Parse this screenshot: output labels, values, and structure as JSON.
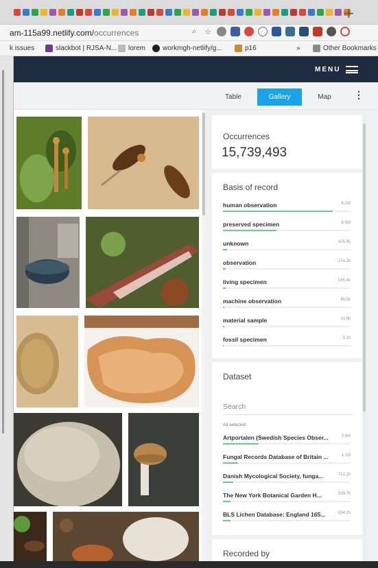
{
  "browser": {
    "url_host": "am-115a99.netlify.com/",
    "url_path": "occurrences",
    "new_tab_symbol": "+",
    "bookmarks": [
      {
        "label": "k issues",
        "icon": "plain"
      },
      {
        "label": "slackbot | RJSA-N...",
        "icon": "slack-icon"
      },
      {
        "label": "lorem",
        "icon": "page-icon"
      },
      {
        "label": "workmgh-netlify/g...",
        "icon": "github-icon"
      },
      {
        "label": "p16",
        "icon": "user-icon"
      },
      {
        "label": "»",
        "icon": "plain"
      },
      {
        "label": "Other Bookmarks",
        "icon": "folder-icon"
      }
    ],
    "accent_colors": [
      "#d84a3a",
      "#3a7bd5",
      "#2ba84a",
      "#f0b429",
      "#9b59b6",
      "#e67e22",
      "#16a085",
      "#c0392b"
    ]
  },
  "header": {
    "menu_label": "MENU"
  },
  "view_tabs": [
    {
      "label": "Table",
      "active": false
    },
    {
      "label": "Gallery",
      "active": true
    },
    {
      "label": "Map",
      "active": false
    }
  ],
  "more_symbol": "⋮",
  "occurrences": {
    "title": "Occurrences",
    "count": "15,739,493"
  },
  "basis_of_record": {
    "title": "Basis of record",
    "items": [
      {
        "label": "human observation",
        "count": "6.2M",
        "fraction": 0.86
      },
      {
        "label": "preserved specimen",
        "count": "6.5M",
        "fraction": 0.42
      },
      {
        "label": "unknown",
        "count": "425.8k",
        "fraction": 0.03
      },
      {
        "label": "observation",
        "count": "274.2k",
        "fraction": 0.02
      },
      {
        "label": "living specimen",
        "count": "165.4k",
        "fraction": 0.02
      },
      {
        "label": "machine observation",
        "count": "45.5k",
        "fraction": 0.01
      },
      {
        "label": "material sample",
        "count": "33.6k",
        "fraction": 0.01
      },
      {
        "label": "fossil specimen",
        "count": "3.1k",
        "fraction": 0.005
      }
    ]
  },
  "dataset": {
    "title": "Dataset",
    "search_label": "Search",
    "all_selected": "All selected",
    "items": [
      {
        "label": "Artportalen (Swedish Species Obser...",
        "count": "2.4M",
        "fraction": 0.28
      },
      {
        "label": "Fungal Records Database of Britain ...",
        "count": "1.1M",
        "fraction": 0.12
      },
      {
        "label": "Danish Mycological Society, funga...",
        "count": "712.1k",
        "fraction": 0.08
      },
      {
        "label": "The New York Botanical Garden H...",
        "count": "559.7k",
        "fraction": 0.06
      },
      {
        "label": "BLS Lichen Database: England 165...",
        "count": "554.1k",
        "fraction": 0.06
      }
    ]
  },
  "recorded_by": {
    "title": "Recorded by"
  }
}
